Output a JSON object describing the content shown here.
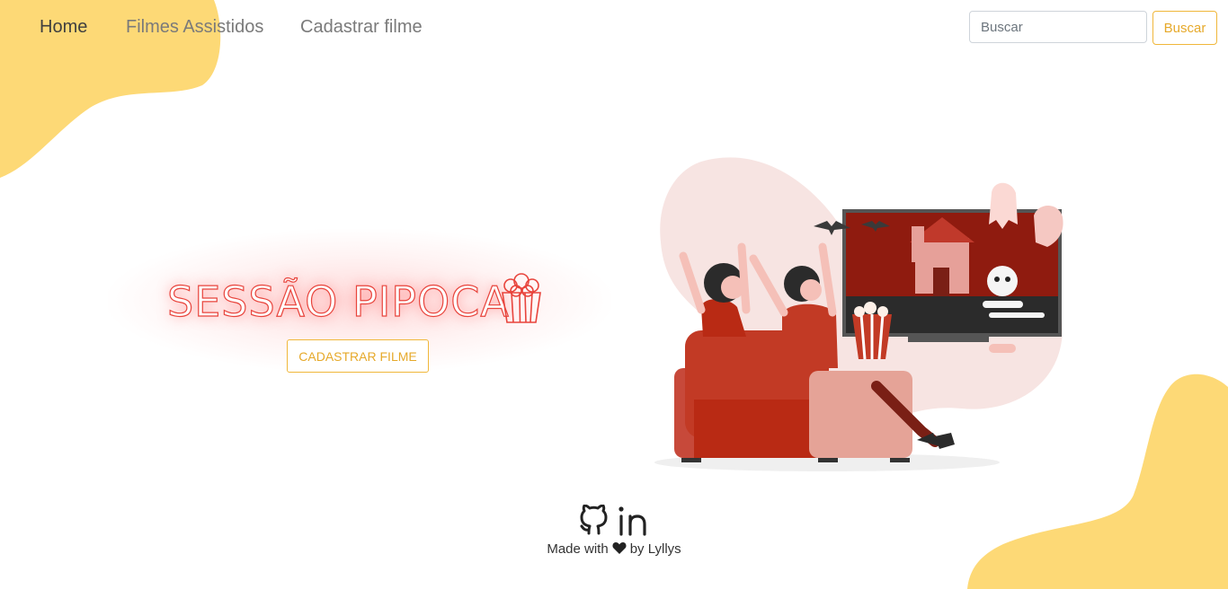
{
  "nav": {
    "items": [
      {
        "label": "Home",
        "active": true
      },
      {
        "label": "Filmes Assistidos",
        "active": false
      },
      {
        "label": "Cadastrar filme",
        "active": false
      }
    ],
    "search": {
      "placeholder": "Buscar",
      "button_label": "Buscar"
    }
  },
  "hero": {
    "title": "SESSÃO PIPOCA",
    "icon": "popcorn-icon",
    "button_label": "CADASTRAR FILME"
  },
  "footer": {
    "icons": [
      "github-icon",
      "linkedin-icon"
    ],
    "text_before": "Made with",
    "heart_icon": "heart-icon",
    "text_after": "by Lyllys"
  },
  "colors": {
    "accent": "#f0b73a",
    "blob": "#fdd976",
    "title_neon": "#e8443c",
    "background": "#ffffff"
  }
}
